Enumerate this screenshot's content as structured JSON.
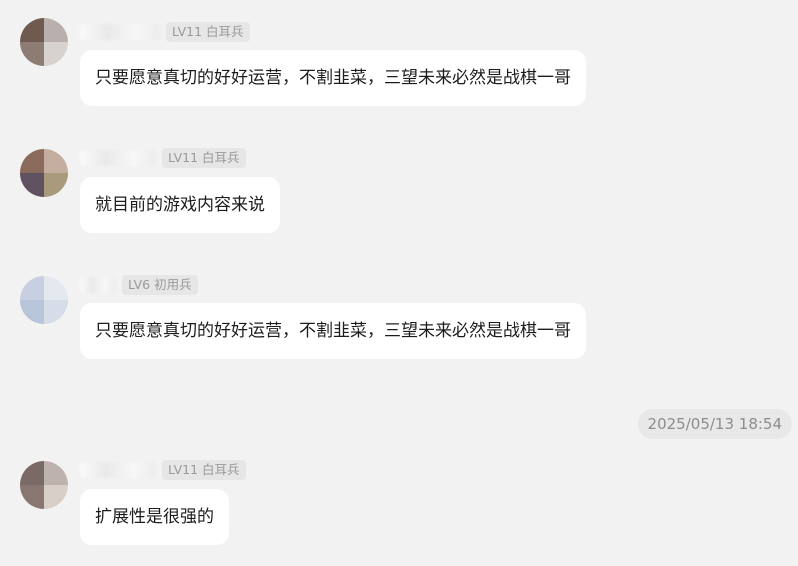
{
  "messages": [
    {
      "badge": "LV11 白耳兵",
      "text": "只要愿意真切的好好运营，不割韭菜，三望未来必然是战棋一哥"
    },
    {
      "badge": "LV11 白耳兵",
      "text": "就目前的游戏内容来说"
    },
    {
      "badge": "LV6 初用兵",
      "text": "只要愿意真切的好好运营，不割韭菜，三望未来必然是战棋一哥"
    },
    {
      "badge": "LV11 白耳兵",
      "text": "扩展性是很强的"
    }
  ],
  "timestamp": "2025/05/13 18:54",
  "colors": {
    "background": "#f2f2f2",
    "bubble": "#ffffff",
    "badge_bg": "#e6e6e6",
    "badge_text": "#9a9a9a",
    "text": "#1c1c1c"
  }
}
